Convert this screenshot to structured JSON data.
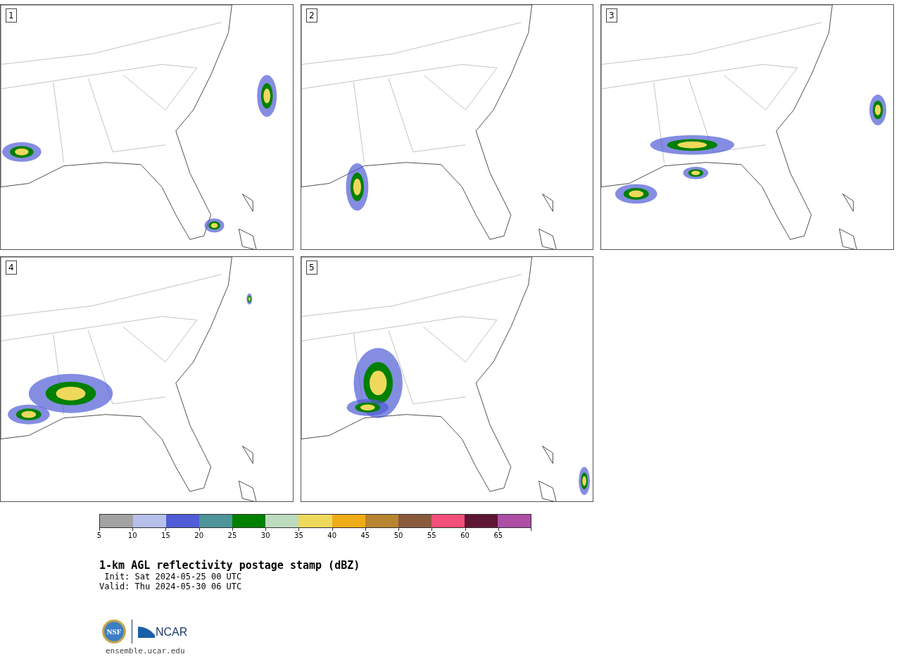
{
  "panels": [
    {
      "label": "1"
    },
    {
      "label": "2"
    },
    {
      "label": "3"
    },
    {
      "label": "4"
    },
    {
      "label": "5"
    }
  ],
  "legend": {
    "bins": [
      {
        "color": "#a3a3a3"
      },
      {
        "color": "#b7c0ea"
      },
      {
        "color": "#505dd6"
      },
      {
        "color": "#4d959a"
      },
      {
        "color": "#008000"
      },
      {
        "color": "#bddcbd"
      },
      {
        "color": "#efd95c"
      },
      {
        "color": "#efac18"
      },
      {
        "color": "#b88430"
      },
      {
        "color": "#8a5a3c"
      },
      {
        "color": "#f24f7a"
      },
      {
        "color": "#5f1634"
      },
      {
        "color": "#ab4ea4"
      }
    ],
    "ticks": [
      "5",
      "10",
      "15",
      "20",
      "25",
      "30",
      "35",
      "40",
      "45",
      "50",
      "55",
      "60",
      "65"
    ]
  },
  "title": "1-km AGL reflectivity postage stamp (dBZ)",
  "init": " Init: Sat 2024-05-25 00 UTC",
  "valid": "Valid: Thu 2024-05-30 06 UTC",
  "logos": {
    "nsf": "NSF",
    "ncar": "NCAR"
  },
  "url": "ensemble.ucar.edu"
}
